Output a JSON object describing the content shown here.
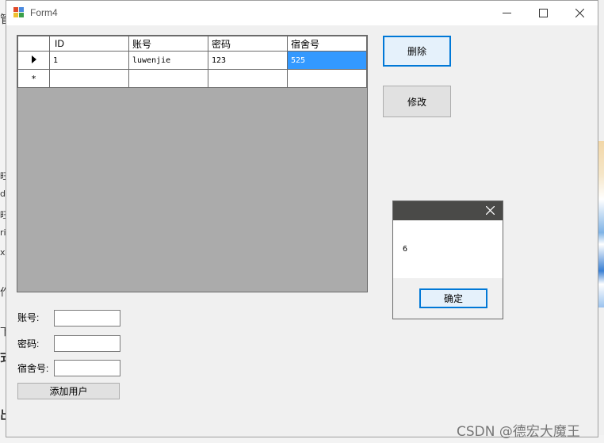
{
  "window": {
    "title": "Form4"
  },
  "grid": {
    "columns": [
      "ID",
      "账号",
      "密码",
      "宿舍号"
    ],
    "rows": [
      {
        "id": "1",
        "account": "luwenjie",
        "password": "123",
        "dorm": "525"
      }
    ],
    "new_row_marker": "*"
  },
  "buttons": {
    "delete": "删除",
    "edit": "修改",
    "add_user": "添加用户"
  },
  "form": {
    "account_label": "账号:",
    "password_label": "密码:",
    "dorm_label": "宿舍号:",
    "account_value": "",
    "password_value": "",
    "dorm_value": ""
  },
  "msgbox": {
    "message": "6",
    "ok": "确定"
  },
  "background": {
    "chars": [
      "管",
      "旺",
      "d",
      "旺",
      "ri",
      "x",
      "作",
      "下",
      "式",
      "出"
    ]
  },
  "watermark": "CSDN @德宏大魔王",
  "colors": {
    "selection": "#3399ff",
    "focus_border": "#0078d7",
    "grid_background": "#ababab",
    "msgbox_titlebar": "#4a4a48"
  },
  "icons": {
    "row_indicator": "current-row-arrow-icon",
    "new_row": "new-row-asterisk-icon",
    "minimize": "minimize-icon",
    "maximize": "maximize-icon",
    "close": "close-icon",
    "app": "form-app-icon"
  }
}
